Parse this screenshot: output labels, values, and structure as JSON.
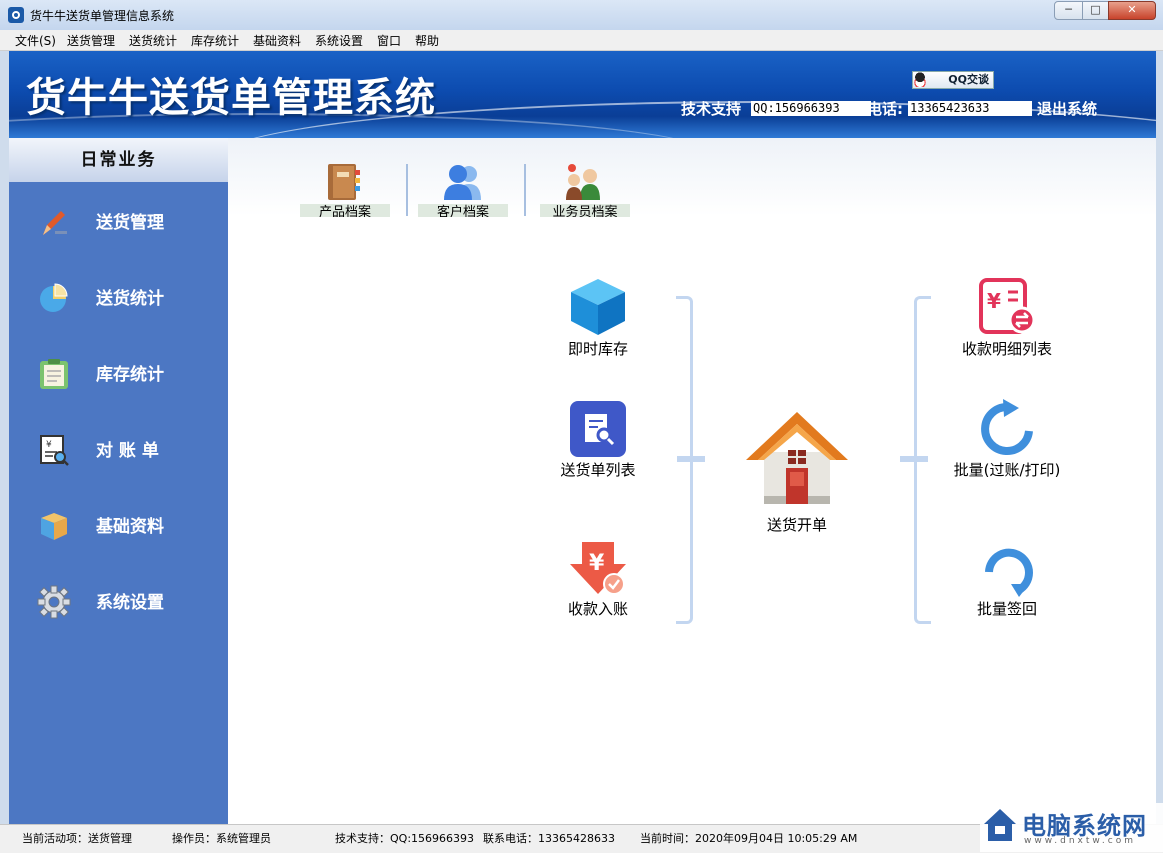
{
  "window": {
    "title": "货牛牛送货单管理信息系统",
    "min": "─",
    "max": "□",
    "close": "✕"
  },
  "menu": [
    "文件(S)",
    "送货管理",
    "送货统计",
    "库存统计",
    "基础资料",
    "系统设置",
    "窗口",
    "帮助"
  ],
  "banner": {
    "title": "货牛牛送货单管理系统",
    "qq_button": "QQ交谈",
    "tech_label": "技术支持",
    "qq_value": "QQ:156966393",
    "phone_label": "电话:",
    "phone_value": "13365423633",
    "exit": "退出系统"
  },
  "sidebar": {
    "header": "日常业务",
    "items": [
      {
        "label": "送货管理",
        "icon": "pen-icon"
      },
      {
        "label": "送货统计",
        "icon": "pie-chart-icon"
      },
      {
        "label": "库存统计",
        "icon": "clipboard-icon"
      },
      {
        "label": "对 账 单",
        "icon": "statement-icon"
      },
      {
        "label": "基础资料",
        "icon": "box-icon"
      },
      {
        "label": "系统设置",
        "icon": "gear-icon"
      }
    ]
  },
  "toolbar": [
    "产品档案",
    "客户档案",
    "业务员档案"
  ],
  "workflow": {
    "left": [
      "即时库存",
      "送货单列表",
      "收款入账"
    ],
    "center": "送货开单",
    "right": [
      "收款明细列表",
      "批量(过账/打印)",
      "批量签回"
    ]
  },
  "status": {
    "activity": "当前活动项：送货管理",
    "operator": "操作员：系统管理员",
    "support": "技术支持：QQ:156966393",
    "phone": "联系电话：13365428633",
    "time": "当前时间：2020年09月04日 10:05:29 AM"
  },
  "watermark": {
    "text": "电脑系统网",
    "url": "www.dnxtw.com"
  }
}
